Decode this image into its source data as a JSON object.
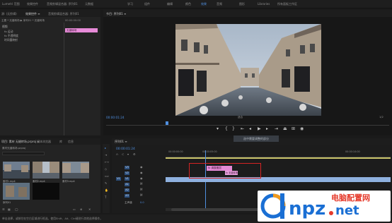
{
  "menubar": {
    "items": [
      "Lumetri 范围",
      "效果控件",
      "音频剪辑混合器: 序列01",
      "元数据",
      "学习",
      "组件",
      "编辑",
      "颜色",
      "效果",
      "音频",
      "图形",
      "Libraries",
      "所有面板工作区"
    ],
    "right_tabs": [
      "节目: 序列01",
      "≡",
      "字幕",
      "效果",
      "效果控件"
    ]
  },
  "source_panel": {
    "tabs": [
      "源: (无剪辑)",
      "效果控件 ≡",
      "音频剪辑混合器: 序列01",
      "元数据"
    ],
    "clip_line": "主要 * 无缝转场 ▶ 序列01 * 无缝转场",
    "rows": [
      {
        "label": "视频"
      },
      {
        "label": "fx 运动"
      },
      {
        "label": "fx 不透明度"
      },
      {
        "label": "时间重映射"
      }
    ],
    "timecode": "00:00:00:00",
    "clip_chip": "无缝转场",
    "bottom_timecode": "00:00:01:24"
  },
  "program": {
    "title": "节目: 序列01 ≡",
    "timecode": "00:00:01:24",
    "fit": "适合",
    "ratio": "1/2"
  },
  "project": {
    "tabs": [
      "项目: 素材 无缝转场.prproj ≡",
      "媒体浏览器",
      "库",
      "信息"
    ],
    "path": "素材无缝转场.prproj",
    "thumbs": [
      {
        "label": "素材1.mp4",
        "duration": "2:18"
      },
      {
        "label": "素材2.mp4",
        "duration": "3:10"
      },
      {
        "label": "素材3.mp4",
        "duration": "1:05"
      },
      {
        "label": "序列01",
        "duration": "5:13"
      }
    ]
  },
  "timeline": {
    "title": "序列01 ≡",
    "timecode": "00:00:01:24",
    "ruler": [
      "00:00:00:00",
      "00:00:05:00",
      "00:00:10:00"
    ],
    "tracks": [
      "V3",
      "V2",
      "V1",
      "A1",
      "A2",
      "A3",
      "主声道"
    ],
    "master_value": "0.0",
    "clip_label": "fx 调整图层",
    "clip_label2": "fx 无缝转场",
    "watermark": "选中需要调整的部分"
  },
  "status": {
    "text": "单击选择，或按住在空白区域进行框选。使用Shift、Alt、Ctrl键进行其他选择操作。"
  },
  "logo": {
    "cn": "电脑配置网",
    "domain": "dnpz.net",
    "colors": {
      "blue": "#1a6fd4",
      "orange": "#f09a1e",
      "red": "#e53a2b"
    }
  }
}
